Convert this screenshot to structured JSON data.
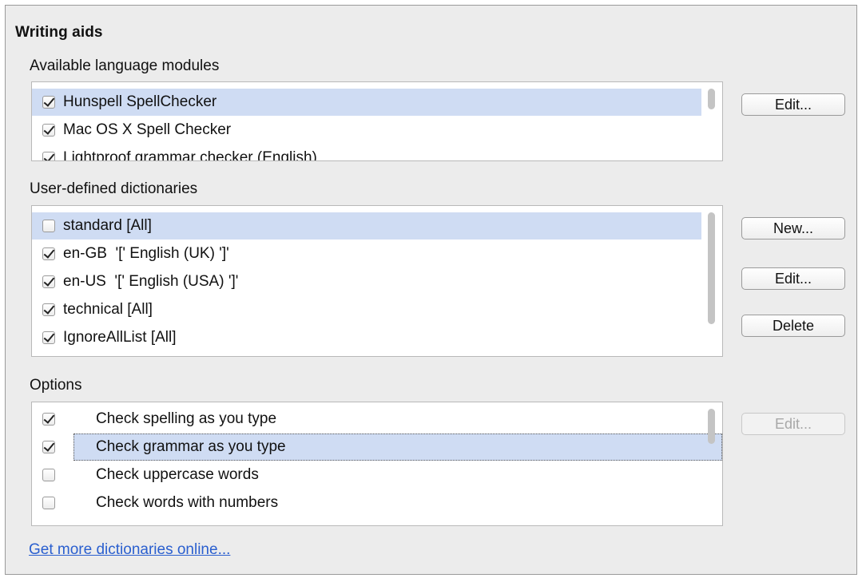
{
  "title": "Writing aids",
  "modules": {
    "label": "Available language modules",
    "items": [
      {
        "label": "Hunspell SpellChecker",
        "checked": true
      },
      {
        "label": "Mac OS X Spell Checker",
        "checked": true
      },
      {
        "label": "Lightproof grammar checker (English)",
        "checked": true
      }
    ],
    "edit_label": "Edit..."
  },
  "dictionaries": {
    "label": "User-defined dictionaries",
    "items": [
      {
        "label": "standard [All]",
        "checked": false
      },
      {
        "label": "en-GB  '[' English (UK) ']'",
        "checked": true
      },
      {
        "label": "en-US  '[' English (USA) ']'",
        "checked": true
      },
      {
        "label": "technical [All]",
        "checked": true
      },
      {
        "label": "IgnoreAllList [All]",
        "checked": true
      }
    ],
    "new_label": "New...",
    "edit_label": "Edit...",
    "delete_label": "Delete"
  },
  "options": {
    "label": "Options",
    "items": [
      {
        "label": "Check spelling as you type",
        "checked": true
      },
      {
        "label": "Check grammar as you type",
        "checked": true
      },
      {
        "label": "Check uppercase words",
        "checked": false
      },
      {
        "label": "Check words with numbers",
        "checked": false
      }
    ],
    "edit_label": "Edit..."
  },
  "more_link": "Get more dictionaries online..."
}
